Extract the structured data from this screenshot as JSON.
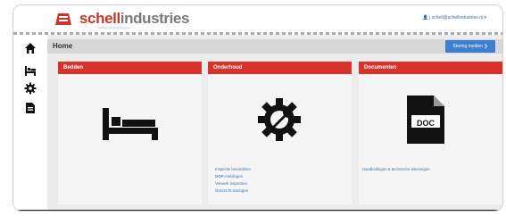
{
  "brand": {
    "name_part1": "schell",
    "name_part2": "industries",
    "tagline": "building industrial solutions",
    "color_primary": "#c8362b",
    "color_secondary": "#7a7a7a"
  },
  "header": {
    "user_link": "j.schell@schellindustries.nl ▾"
  },
  "sidebar": {
    "items": [
      {
        "icon": "home-icon"
      },
      {
        "icon": "bed-icon"
      },
      {
        "icon": "gear-icon"
      },
      {
        "icon": "document-icon"
      }
    ]
  },
  "breadcrumb": {
    "title": "Home",
    "action_label": "Storing melden ❯"
  },
  "panels": [
    {
      "title": "Bedden",
      "icon": "bed-icon",
      "links": []
    },
    {
      "title": "Onderhoud",
      "icon": "wrench-gear-icon",
      "links": [
        "Inspectie beoordelen",
        "MDR-meldingen",
        "Verwerk inspecties",
        "Overzicht storingen"
      ]
    },
    {
      "title": "Documenten",
      "icon": "doc-file-icon",
      "icon_label": "DOC",
      "links": [
        "Handleidingen & technische tekeningen"
      ]
    }
  ],
  "colors": {
    "panel_header": "#d8322b",
    "action_button": "#3d7fd1",
    "link": "#3b6fb3"
  }
}
